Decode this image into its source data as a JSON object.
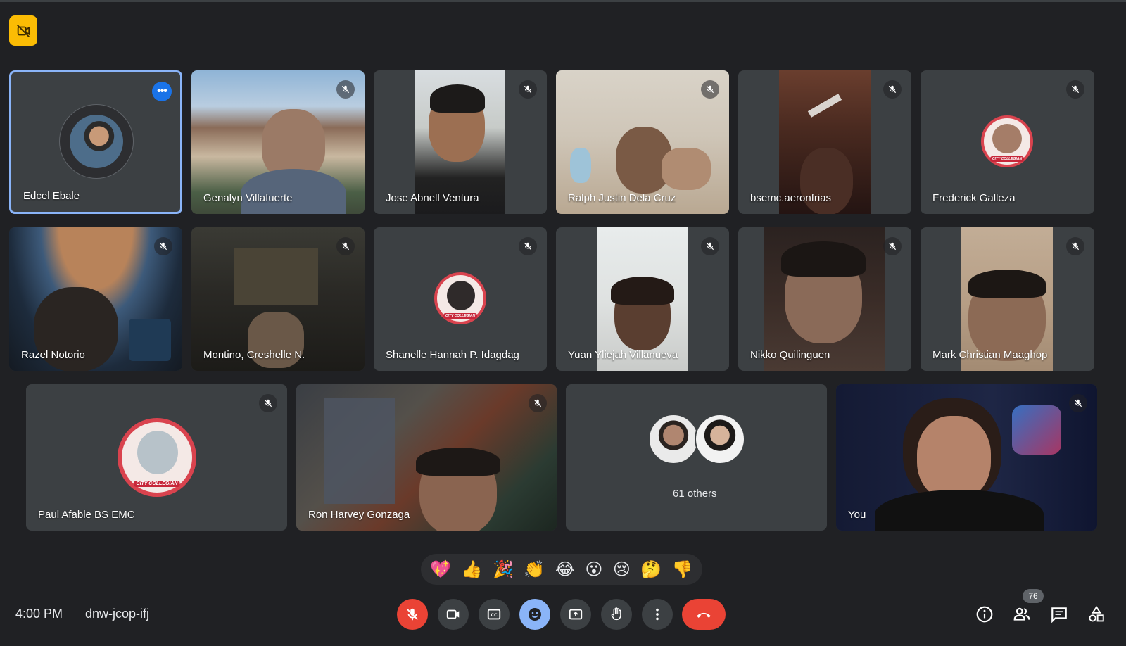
{
  "participants": [
    {
      "name": "Edcel Ebale",
      "muted": false,
      "active": true
    },
    {
      "name": "Genalyn Villafuerte",
      "muted": true
    },
    {
      "name": "Jose Abnell Ventura",
      "muted": true
    },
    {
      "name": "Ralph Justin Dela Cruz",
      "muted": true
    },
    {
      "name": "bsemc.aeronfrias",
      "muted": true
    },
    {
      "name": "Frederick Galleza",
      "muted": true
    },
    {
      "name": "Razel Notorio",
      "muted": true
    },
    {
      "name": "Montino, Creshelle N.",
      "muted": true
    },
    {
      "name": "Shanelle Hannah P. Idagdag",
      "muted": true
    },
    {
      "name": "Yuan Yliejah Villanueva",
      "muted": true
    },
    {
      "name": "Nikko Quilinguen",
      "muted": true
    },
    {
      "name": "Mark Christian Maaghop",
      "muted": true
    },
    {
      "name": "Paul Afable BS EMC",
      "muted": true
    },
    {
      "name": "Ron Harvey Gonzaga",
      "muted": true
    },
    {
      "name": "You",
      "muted": true
    }
  ],
  "others": {
    "label": "61 others"
  },
  "badge_texts": {
    "city_collegian": "CITY COLLEGIAN"
  },
  "reactions": [
    "💖",
    "👍",
    "🎉",
    "👏",
    "😂",
    "😮",
    "😢",
    "🤔",
    "👎"
  ],
  "meeting": {
    "time": "4:00 PM",
    "code": "dnw-jcop-ifj"
  },
  "people_count": "76",
  "colors": {
    "background": "#202124",
    "tile": "#3c4043",
    "active_border": "#8ab4f8",
    "red": "#ea4335",
    "yellow": "#fbbc04"
  }
}
